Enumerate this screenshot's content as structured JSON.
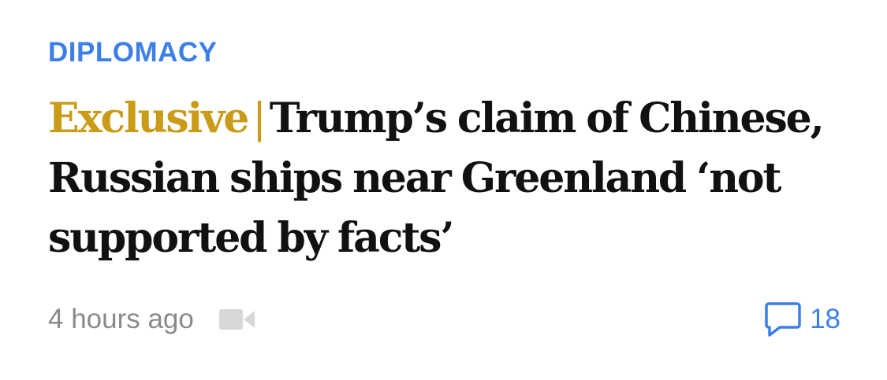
{
  "article": {
    "section": "DIPLOMACY",
    "tag": "Exclusive",
    "separator": "|",
    "title": "Trump’s claim of Chinese, Russian ships near Greenland ‘not supported by facts’",
    "timestamp": "4 hours ago",
    "media_icon": "video-camera-icon",
    "comment_icon": "speech-bubble-icon",
    "comment_count": "18"
  },
  "colors": {
    "section": "#3d7fe6",
    "tag": "#c99b16",
    "title": "#111111",
    "meta_gray": "#8a8a8a",
    "video_icon": "#d8d8d8",
    "comment_blue": "#3d7fe6"
  }
}
